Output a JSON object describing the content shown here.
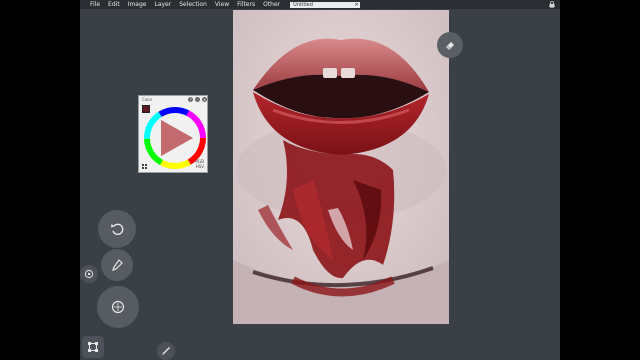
{
  "menubar": {
    "items": [
      "File",
      "Edit",
      "Image",
      "Layer",
      "Selection",
      "View",
      "Filters",
      "Other"
    ],
    "document_tab": "Untitled",
    "close_glyph": "✕"
  },
  "color_panel": {
    "title": "Color",
    "buttons": [
      "?",
      "-",
      "x"
    ],
    "modes": [
      "RGB",
      "HSV"
    ]
  },
  "tools": {
    "eraser": "eraser-icon",
    "undo": "undo-icon",
    "eyedropper": "eyedropper-icon",
    "brush_size": "brush-size-icon",
    "rotate": "rotate-icon",
    "transform": "transform-icon",
    "pen": "pen-icon"
  },
  "colors": {
    "background": "#3b4047",
    "menubar": "#2a2e33",
    "canvas_base": "#d9cacd",
    "blood": "#8c1418"
  }
}
